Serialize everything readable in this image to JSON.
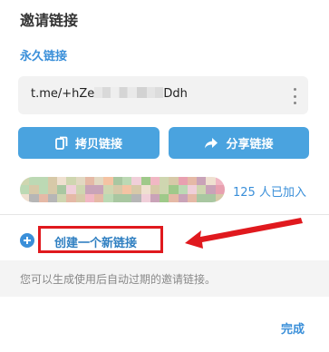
{
  "dialog": {
    "title": "邀请链接",
    "permanent_link_label": "永久链接",
    "link": {
      "prefix": "t.me/+hZe",
      "suffix": "Ddh"
    },
    "copy_button_label": "拷贝链接",
    "share_button_label": "分享链接",
    "joined_text": "125 人已加入",
    "create_new_link_label": "创建一个新链接",
    "hint_text": "您可以生成使用后自动过期的邀请链接。",
    "done_label": "完成"
  },
  "colors": {
    "accent": "#3a8fd9",
    "button": "#4aa3df",
    "annotation_red": "#e0191e"
  },
  "icons": {
    "more": "more-vertical-icon",
    "copy": "copy-icon",
    "share": "share-arrow-icon",
    "add": "plus-circle-icon",
    "annotation": "red-arrow-icon"
  }
}
